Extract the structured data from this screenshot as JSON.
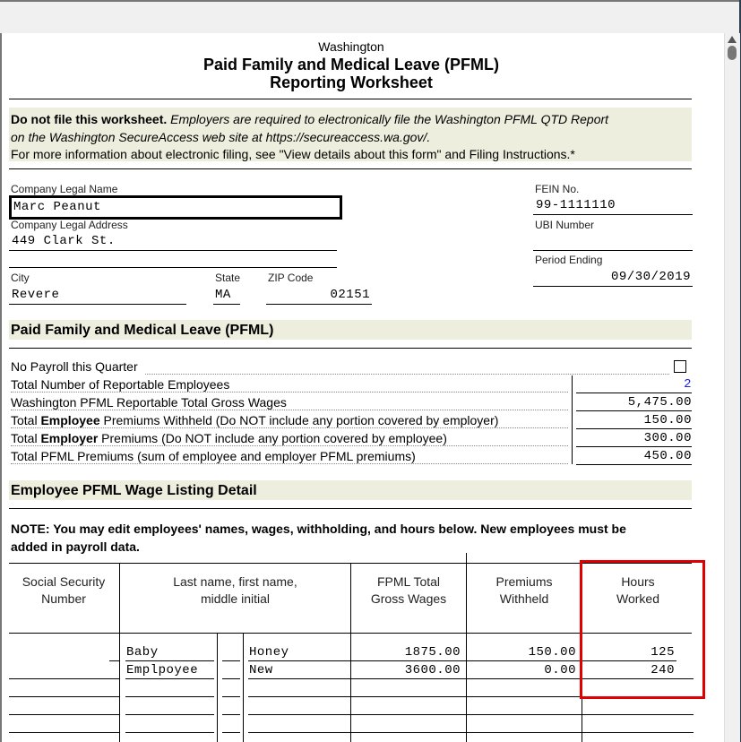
{
  "form": {
    "state": "Washington",
    "title_line1": "Paid Family and Medical Leave (PFML)",
    "title_line2": "Reporting Worksheet"
  },
  "notice": {
    "bold": "Do not file this worksheet.",
    "italic_1": " Employers are required to electronically file the Washington PFML QTD Report",
    "italic_2": "on the Washington SecureAccess web site at https://secureaccess.wa.gov/.",
    "line3": "For more information about electronic filing, see \"View details about this form\" and Filing Instructions.*"
  },
  "company": {
    "name_label": "Company Legal Name",
    "name_value": "Marc Peanut",
    "address_label": "Company Legal Address",
    "address_value": "449 Clark St.",
    "address2_value": "",
    "city_label": "City",
    "city_value": "Revere",
    "state_label": "State",
    "state_value": "MA",
    "zip_label": "ZIP Code",
    "zip_value": "02151",
    "fein_label": "FEIN No.",
    "fein_value": "99-1111110",
    "ubi_label": "UBI Number",
    "ubi_value": "",
    "period_label": "Period Ending",
    "period_value": "09/30/2019"
  },
  "pfml": {
    "section_title": "Paid Family and Medical Leave (PFML)",
    "no_payroll_label": "No Payroll this Quarter",
    "no_payroll_checked": false,
    "lines": [
      {
        "pre": "Total Number of Reportable Employees",
        "bold": "",
        "post": "",
        "value": "2",
        "color": "#2020e0"
      },
      {
        "pre": "Washington PFML Reportable Total Gross Wages",
        "bold": "",
        "post": "",
        "value": "5,475.00",
        "color": "#000000"
      },
      {
        "pre": "Total ",
        "bold": "Employee",
        "post": " Premiums Withheld (Do NOT include any portion covered by employer)",
        "value": "150.00",
        "color": "#000000"
      },
      {
        "pre": "Total ",
        "bold": "Employer",
        "post": " Premiums (Do NOT include any portion covered by employee)",
        "value": "300.00",
        "color": "#000000"
      },
      {
        "pre": "Total PFML Premiums (sum of employee and employer PFML premiums)",
        "bold": "",
        "post": "",
        "value": "450.00",
        "color": "#000000"
      }
    ]
  },
  "listing": {
    "section_title": "Employee PFML Wage Listing Detail",
    "note_line1": "NOTE:  You may edit employees' names, wages, withholding, and hours below. New employees must be",
    "note_line2": "added in payroll data.",
    "headers": {
      "ssn_1": "Social Security",
      "ssn_2": "Number",
      "name_1": "Last name, first name,",
      "name_2": "middle initial",
      "wages_1": "FPML Total",
      "wages_2": "Gross Wages",
      "prem_1": "Premiums",
      "prem_2": "Withheld",
      "hours_1": "Hours",
      "hours_2": "Worked"
    },
    "rows": [
      {
        "ssn": "",
        "last": "Baby",
        "mi": "",
        "first": "Honey",
        "wages": "1875.00",
        "premiums": "150.00",
        "hours": "125"
      },
      {
        "ssn": "",
        "last": "Emplpoyee",
        "mi": "",
        "first": "New",
        "wages": "3600.00",
        "premiums": "0.00",
        "hours": "240"
      },
      {
        "ssn": "",
        "last": "",
        "mi": "",
        "first": "",
        "wages": "",
        "premiums": "",
        "hours": ""
      },
      {
        "ssn": "",
        "last": "",
        "mi": "",
        "first": "",
        "wages": "",
        "premiums": "",
        "hours": ""
      },
      {
        "ssn": "",
        "last": "",
        "mi": "",
        "first": "",
        "wages": "",
        "premiums": "",
        "hours": ""
      }
    ]
  },
  "highlight_color": "#e00000",
  "shade_color": "#eeeedf"
}
